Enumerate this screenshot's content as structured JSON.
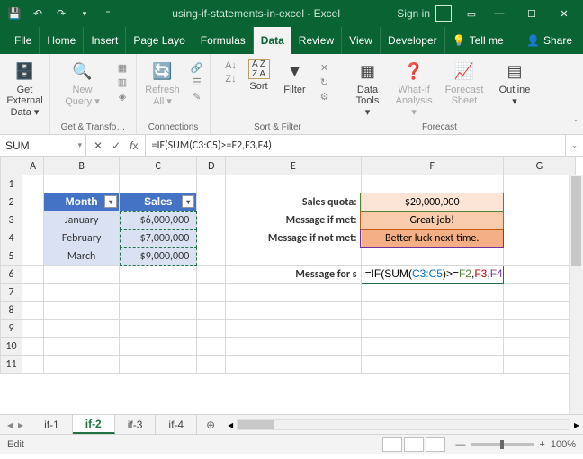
{
  "title": "using-if-statements-in-excel - Excel",
  "signin": "Sign in",
  "menu": {
    "file": "File",
    "home": "Home",
    "insert": "Insert",
    "pagelayout": "Page Layo",
    "formulas": "Formulas",
    "data": "Data",
    "review": "Review",
    "view": "View",
    "developer": "Developer",
    "tellme": "Tell me",
    "share": "Share"
  },
  "ribbon": {
    "getdata": "Get External Data ▾",
    "newquery": "New Query ▾",
    "refresh": "Refresh All ▾",
    "sort": "Sort",
    "filter": "Filter",
    "datatools": "Data Tools ▾",
    "whatif": "What-If Analysis ▾",
    "forecast": "Forecast Sheet",
    "outline": "Outline ▾",
    "grp_transform": "Get & Transfo…",
    "grp_conn": "Connections",
    "grp_sortfilter": "Sort & Filter",
    "grp_forecast": "Forecast"
  },
  "namebox": "SUM",
  "formula": "=IF(SUM(C3:C5)>=F2,F3,F4)",
  "cols": [
    "A",
    "B",
    "C",
    "D",
    "E",
    "F",
    "G"
  ],
  "table": {
    "h1": "Month",
    "h2": "Sales",
    "rows": [
      {
        "m": "January",
        "s": "$6,000,000"
      },
      {
        "m": "February",
        "s": "$7,000,000"
      },
      {
        "m": "March",
        "s": "$9,000,000"
      }
    ]
  },
  "labels": {
    "quota": "Sales quota:",
    "met": "Message if met:",
    "notmet": "Message if not met:",
    "msgfor": "Message for s"
  },
  "fvals": {
    "f2": "$20,000,000",
    "f3": "Great job!",
    "f4": "Better luck next time."
  },
  "editformula": {
    "pre": "=IF(",
    "sum": "SUM",
    "p1": "(",
    "range": "C3:C5",
    "p2": ")>=",
    "f2": "F2",
    "c1": ",",
    "f3": "F3",
    "c2": ",",
    "f4": "F4",
    "end": ")"
  },
  "tabs": [
    "if-1",
    "if-2",
    "if-3",
    "if-4"
  ],
  "activeTab": "if-2",
  "status": {
    "mode": "Edit",
    "zoom": "100%"
  }
}
